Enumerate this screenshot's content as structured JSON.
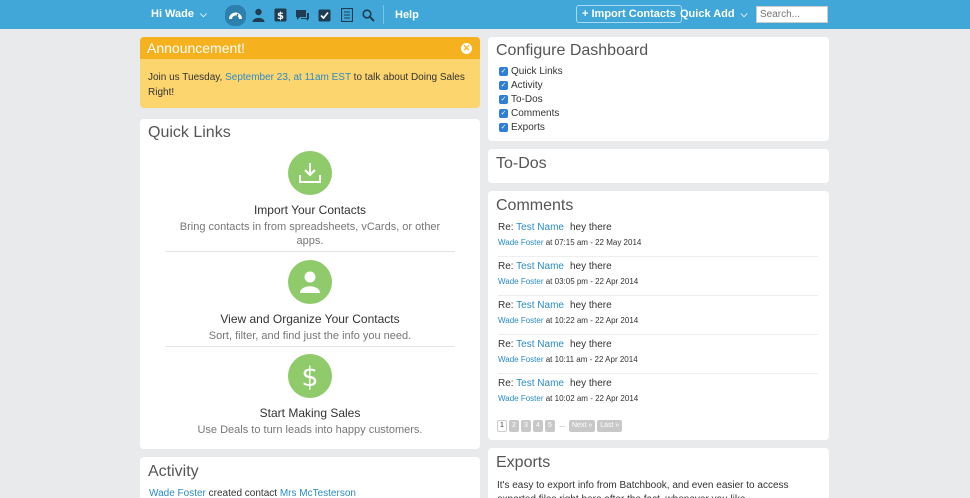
{
  "nav": {
    "greeting": "Hi Wade",
    "icons": [
      "dashboard-icon",
      "contacts-icon",
      "deals-icon",
      "comments-icon",
      "todos-icon",
      "reports-icon",
      "search-icon"
    ],
    "help": "Help",
    "import_contacts": "+ Import Contacts",
    "quick_add": "Quick Add",
    "search_placeholder": "Search...",
    "color": "#40a7d8"
  },
  "announcement": {
    "title": "Announcement!",
    "text_before": "Join us Tuesday, ",
    "link": "September 23, at 11am EST",
    "text_after": " to talk about Doing Sales Right!",
    "bar_color": "#f5b11e",
    "bg_color": "#fcd56f"
  },
  "quick_links": {
    "title": "Quick Links",
    "items": [
      {
        "icon": "download-icon",
        "heading": "Import Your Contacts",
        "desc": "Bring contacts in from spreadsheets, vCards, or other apps."
      },
      {
        "icon": "person-icon",
        "heading": "View and Organize Your Contacts",
        "desc": "Sort, filter, and find just the info you need."
      },
      {
        "icon": "dollar-icon",
        "heading": "Start Making Sales",
        "desc": "Use Deals to turn leads into happy customers."
      }
    ],
    "circle_color": "#8fcb6b"
  },
  "activity": {
    "title": "Activity",
    "row": {
      "user": "Wade Foster",
      "action": " created contact ",
      "target": "Mrs McTesterson"
    }
  },
  "configure": {
    "title": "Configure Dashboard",
    "options": [
      "Quick Links",
      "Activity",
      "To-Dos",
      "Comments",
      "Exports"
    ]
  },
  "todos": {
    "title": "To-Dos"
  },
  "comments": {
    "title": "Comments",
    "items": [
      {
        "re": "Re:",
        "name": "Test Name",
        "text": "hey there",
        "author": "Wade Foster",
        "when": " at 07:15 am - 22 May 2014"
      },
      {
        "re": "Re:",
        "name": "Test Name",
        "text": "hey there",
        "author": "Wade Foster",
        "when": " at 03:05 pm - 22 Apr 2014"
      },
      {
        "re": "Re:",
        "name": "Test Name",
        "text": "hey there",
        "author": "Wade Foster",
        "when": " at 10:22 am - 22 Apr 2014"
      },
      {
        "re": "Re:",
        "name": "Test Name",
        "text": "hey there",
        "author": "Wade Foster",
        "when": " at 10:11 am - 22 Apr 2014"
      },
      {
        "re": "Re:",
        "name": "Test Name",
        "text": "hey there",
        "author": "Wade Foster",
        "when": " at 10:02 am - 22 Apr 2014"
      }
    ],
    "pager": [
      "1",
      "2",
      "3",
      "4",
      "5",
      "...",
      "Next »",
      "Last »"
    ]
  },
  "exports": {
    "title": "Exports",
    "text": "It's easy to export info from Batchbook, and even easier to access exported files right here after the fact, whenever you like."
  }
}
